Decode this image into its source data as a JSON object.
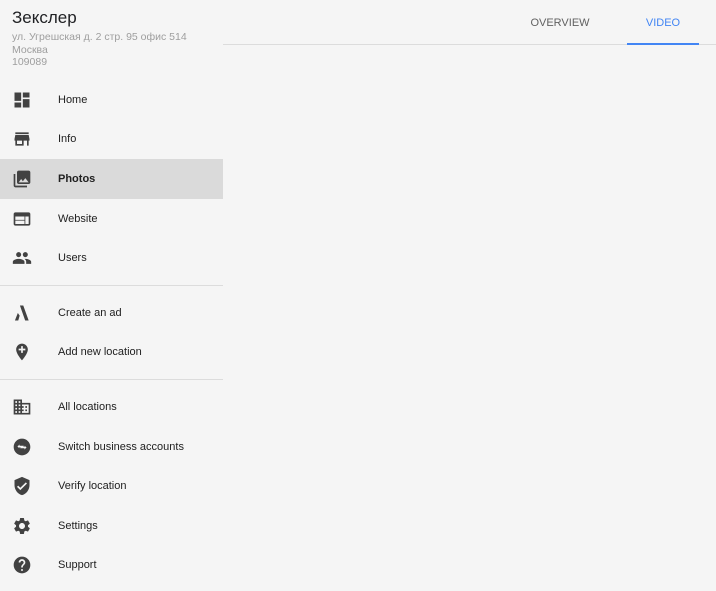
{
  "business": {
    "name": "Зекслер",
    "address_line1": "ул. Угрешская д. 2 стр. 95 офис 514",
    "address_line2": "Москва",
    "address_line3": "109089"
  },
  "nav": {
    "group1": [
      {
        "label": "Home",
        "icon": "dashboard-icon"
      },
      {
        "label": "Info",
        "icon": "storefront-icon"
      },
      {
        "label": "Photos",
        "icon": "photo-library-icon",
        "active": true
      },
      {
        "label": "Website",
        "icon": "web-icon"
      },
      {
        "label": "Users",
        "icon": "people-icon"
      }
    ],
    "group2": [
      {
        "label": "Create an ad",
        "icon": "adwords-icon"
      },
      {
        "label": "Add new location",
        "icon": "add-location-icon"
      }
    ],
    "group3": [
      {
        "label": "All locations",
        "icon": "business-icon"
      },
      {
        "label": "Switch business accounts",
        "icon": "swap-icon"
      },
      {
        "label": "Verify location",
        "icon": "verified-shield-icon"
      },
      {
        "label": "Settings",
        "icon": "gear-icon"
      },
      {
        "label": "Support",
        "icon": "help-icon"
      }
    ]
  },
  "tabs": [
    {
      "label": "OVERVIEW",
      "active": false
    },
    {
      "label": "VIDEO",
      "active": true
    }
  ],
  "colors": {
    "accent": "#4285f4",
    "active_bg": "#dadada",
    "background": "#f5f5f5"
  }
}
